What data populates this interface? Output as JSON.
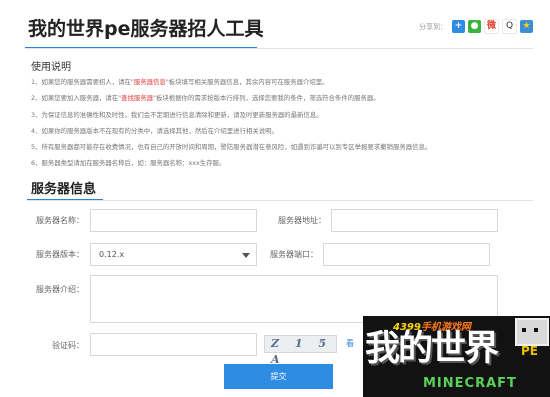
{
  "page": {
    "title": "我的世界pe服务器招人工具"
  },
  "share": {
    "label": "分享到：",
    "icons": [
      {
        "name": "plus-share-icon",
        "glyph": "+"
      },
      {
        "name": "wechat-icon",
        "glyph": "●"
      },
      {
        "name": "weibo-icon",
        "glyph": "微"
      },
      {
        "name": "qq-icon",
        "glyph": "Q"
      },
      {
        "name": "qzone-star-icon",
        "glyph": "★"
      }
    ]
  },
  "usage": {
    "title": "使用说明",
    "items": [
      {
        "pre": "1、如果您的服务器需要招人，请在\"",
        "hl": "服务器信息",
        "post": "\"板块填写相关服务器信息，其余内容可在服务器介绍里。"
      },
      {
        "pre": "2、如果您要加入服务器，请在\"",
        "hl": "查找服务器",
        "post": "\"板块根据你的需求按版本行排列，选择您要我的条件，筛选符合条件的服务器。"
      },
      {
        "pre": "3、为保证信息的准确性和及时性，我们会不定期进行信息清除和更新，请及时更新服务器的最新信息。",
        "hl": "",
        "post": ""
      },
      {
        "pre": "4、如果你的服务器版本不在现有的分类中，请选择其他，然后在介绍里进行相关说明。",
        "hl": "",
        "post": ""
      },
      {
        "pre": "5、所有服务器都可能存在收费情况，也有自己的开放时间和周期，警防服务器潜在意风险，如遇到诈骗可以到专区举报要求撤销服务器信息。",
        "hl": "",
        "post": ""
      },
      {
        "pre": "6、服务器类型请加在服务器名称后，如：服务器名称：xxx生存服。",
        "hl": "",
        "post": ""
      }
    ]
  },
  "form": {
    "section_title": "服务器信息",
    "name_label": "服务器名称：",
    "address_label": "服务器地址：",
    "version_label": "服务器版本：",
    "version_value": "0.12.x",
    "port_label": "服务器端口：",
    "intro_label": "服务器介绍：",
    "captcha_label": "验证码：",
    "captcha_image_text": "Z 1 5 A",
    "refresh_label": "看",
    "submit_label": "提交"
  },
  "ad": {
    "top_prefix": "4399",
    "top_text": "手机游戏网",
    "main_text": "我的世界",
    "pe_text": "PE",
    "bottom_text": "MINECRAFT"
  }
}
